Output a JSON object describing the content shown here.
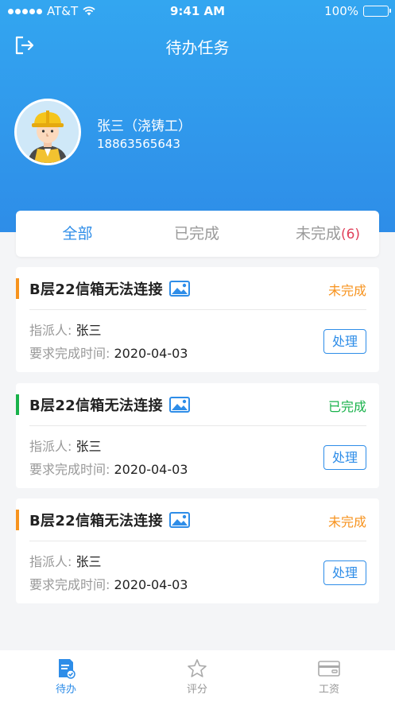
{
  "status_bar": {
    "carrier": "AT&T",
    "time": "9:41 AM",
    "battery": "100%"
  },
  "nav": {
    "title": "待办任务"
  },
  "user": {
    "name": "张三（浇铸工）",
    "phone": "18863565643"
  },
  "tabs": [
    {
      "label": "全部",
      "active": true
    },
    {
      "label": "已完成",
      "active": false
    },
    {
      "label": "未完成",
      "badge": "(6)",
      "active": false
    }
  ],
  "tasks": [
    {
      "title": "B层22信箱无法连接",
      "status": "未完成",
      "status_color": "#f7931e",
      "assigner_label": "指派人:",
      "assigner": "张三",
      "due_label": "要求完成时间:",
      "due": "2020-04-03",
      "action": "处理"
    },
    {
      "title": "B层22信箱无法连接",
      "status": "已完成",
      "status_color": "#19b24b",
      "assigner_label": "指派人:",
      "assigner": "张三",
      "due_label": "要求完成时间:",
      "due": "2020-04-03",
      "action": "处理"
    },
    {
      "title": "B层22信箱无法连接",
      "status": "未完成",
      "status_color": "#f7931e",
      "assigner_label": "指派人:",
      "assigner": "张三",
      "due_label": "要求完成时间:",
      "due": "2020-04-03",
      "action": "处理"
    }
  ],
  "tabbar": [
    {
      "label": "待办",
      "icon": "todo-icon",
      "active": true
    },
    {
      "label": "评分",
      "icon": "star-icon",
      "active": false
    },
    {
      "label": "工资",
      "icon": "wallet-icon",
      "active": false
    }
  ],
  "colors": {
    "primary": "#2e8de8",
    "pending": "#f7931e",
    "done": "#19b24b",
    "badge": "#e0405a"
  }
}
